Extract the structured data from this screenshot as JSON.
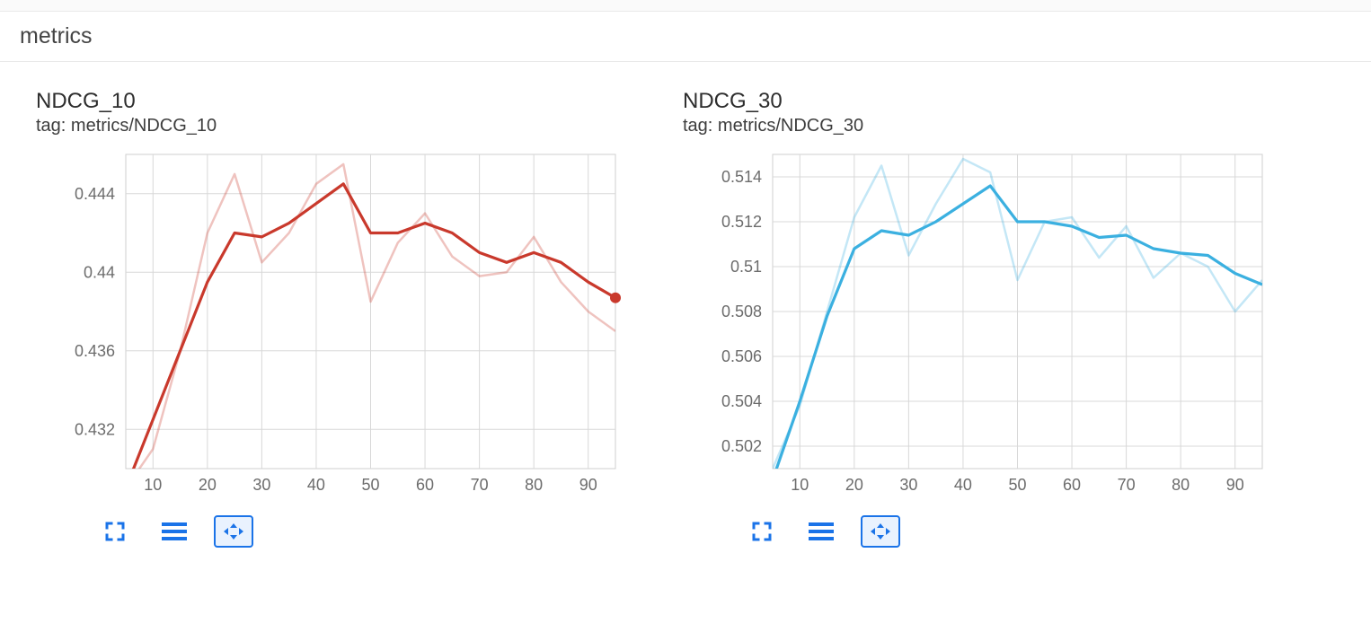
{
  "panel_title": "metrics",
  "chart_data": [
    {
      "id": "ndcg10",
      "type": "line",
      "title": "NDCG_10",
      "tag": "tag: metrics/NDCG_10",
      "x": [
        5,
        10,
        15,
        20,
        25,
        30,
        35,
        40,
        45,
        50,
        55,
        60,
        65,
        70,
        75,
        80,
        85,
        90,
        95
      ],
      "xlim": [
        5,
        95
      ],
      "ylim": [
        0.43,
        0.446
      ],
      "x_ticks": [
        10,
        20,
        30,
        40,
        50,
        60,
        70,
        80,
        90
      ],
      "y_ticks": [
        0.432,
        0.436,
        0.44,
        0.444
      ],
      "y_tick_labels": [
        "0.432",
        "0.436",
        "0.44",
        "0.444"
      ],
      "color": "#c9392c",
      "color_light": "rgba(201,57,44,0.30)",
      "end_marker": true,
      "series": [
        {
          "name": "smoothed",
          "values": [
            0.429,
            0.4325,
            0.436,
            0.4395,
            0.442,
            0.4418,
            0.4425,
            0.4435,
            0.4445,
            0.442,
            0.442,
            0.4425,
            0.442,
            0.441,
            0.4405,
            0.441,
            0.4405,
            0.4395,
            0.4387
          ]
        },
        {
          "name": "raw",
          "values": [
            0.429,
            0.431,
            0.436,
            0.442,
            0.445,
            0.4405,
            0.442,
            0.4445,
            0.4455,
            0.4385,
            0.4415,
            0.443,
            0.4408,
            0.4398,
            0.44,
            0.4418,
            0.4395,
            0.438,
            0.437
          ]
        }
      ]
    },
    {
      "id": "ndcg30",
      "type": "line",
      "title": "NDCG_30",
      "tag": "tag: metrics/NDCG_30",
      "x": [
        5,
        10,
        15,
        20,
        25,
        30,
        35,
        40,
        45,
        50,
        55,
        60,
        65,
        70,
        75,
        80,
        85,
        90,
        95
      ],
      "xlim": [
        5,
        95
      ],
      "ylim": [
        0.501,
        0.515
      ],
      "x_ticks": [
        10,
        20,
        30,
        40,
        50,
        60,
        70,
        80,
        90
      ],
      "y_ticks": [
        0.502,
        0.504,
        0.506,
        0.508,
        0.51,
        0.512,
        0.514
      ],
      "y_tick_labels": [
        "0.502",
        "0.504",
        "0.506",
        "0.508",
        "0.51",
        "0.512",
        "0.514"
      ],
      "color": "#3bb0e0",
      "color_light": "rgba(59,176,224,0.30)",
      "end_marker": false,
      "series": [
        {
          "name": "smoothed",
          "values": [
            0.5005,
            0.504,
            0.5078,
            0.5108,
            0.5116,
            0.5114,
            0.512,
            0.5128,
            0.5136,
            0.512,
            0.512,
            0.5118,
            0.5113,
            0.5114,
            0.5108,
            0.5106,
            0.5105,
            0.5097,
            0.5092
          ]
        },
        {
          "name": "raw",
          "values": [
            0.501,
            0.5038,
            0.508,
            0.5122,
            0.5145,
            0.5105,
            0.5128,
            0.5148,
            0.5142,
            0.5094,
            0.512,
            0.5122,
            0.5104,
            0.5118,
            0.5095,
            0.5106,
            0.51,
            0.508,
            0.5094
          ]
        }
      ]
    }
  ]
}
